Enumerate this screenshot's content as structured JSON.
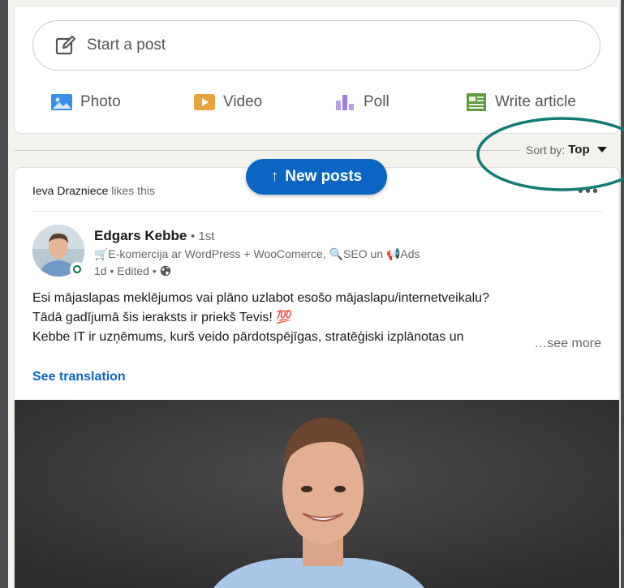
{
  "share": {
    "placeholder": "Start a post",
    "actions": [
      {
        "label": "Photo",
        "icon": "photo-icon",
        "color": "#378fe9"
      },
      {
        "label": "Video",
        "icon": "video-icon",
        "color": "#e7a33e"
      },
      {
        "label": "Poll",
        "icon": "poll-icon",
        "color": "#b8a1e8"
      },
      {
        "label": "Write article",
        "icon": "article-icon",
        "color": "#5f9b41"
      }
    ]
  },
  "sort": {
    "prefix": "Sort by:",
    "value": "Top"
  },
  "new_posts": {
    "label": "New posts",
    "arrow": "↑"
  },
  "post": {
    "liked_by": "Ieva Drazniece",
    "liked_suffix": "likes this",
    "more": "•••",
    "author": "Edgars Kebbe",
    "degree": "• 1st",
    "headline": "🛒E-komercija ar WordPress + WooComerce, 🔍SEO un 📢Ads",
    "meta": "1d • Edited •",
    "lines": [
      "Esi mājaslapas meklējumos vai plāno uzlabot esošo mājaslapu/internetveikalu?",
      "Tādā gadījumā šis ieraksts ir priekš Tevis! 💯",
      "Kebbe IT ir uzņēmums, kurš veido pārdotspējīgas, stratēģiski izplānotas un"
    ],
    "see_more": "…see more",
    "see_translation": "See translation"
  },
  "colors": {
    "brand": "#0a66c2",
    "annotation_oval": "#137a74",
    "online": "#057642"
  }
}
